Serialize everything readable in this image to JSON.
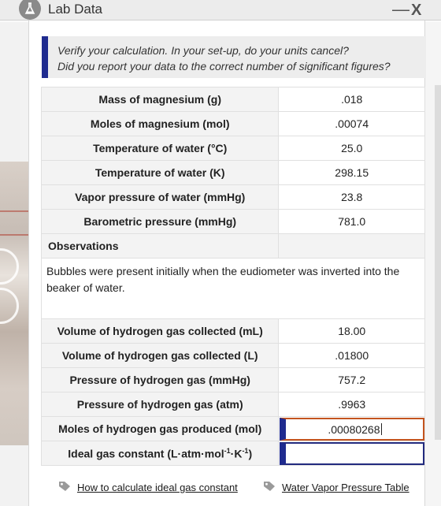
{
  "window": {
    "title": "Lab Data",
    "minimize_label": "—",
    "close_label": "X"
  },
  "notice": {
    "line1": "Verify your calculation. In your set-up, do your units cancel?",
    "line2": "Did you report your data to the correct number of significant figures?"
  },
  "rows_top": [
    {
      "label": "Mass of magnesium (g)",
      "value": ".018"
    },
    {
      "label": "Moles of magnesium (mol)",
      "value": ".00074"
    },
    {
      "label": "Temperature of water (°C)",
      "value": "25.0"
    },
    {
      "label": "Temperature of water (K)",
      "value": "298.15"
    },
    {
      "label": "Vapor pressure of water (mmHg)",
      "value": "23.8"
    },
    {
      "label": "Barometric pressure (mmHg)",
      "value": "781.0"
    }
  ],
  "observations": {
    "label": "Observations",
    "text": "Bubbles were present initially when the eudiometer was inverted into the beaker of water."
  },
  "rows_bottom": [
    {
      "label": "Volume of hydrogen gas collected (mL)",
      "value": "18.00"
    },
    {
      "label": "Volume of hydrogen gas collected (L)",
      "value": ".01800"
    },
    {
      "label": "Pressure of hydrogen gas (mmHg)",
      "value": "757.2"
    },
    {
      "label": "Pressure of hydrogen gas (atm)",
      "value": ".9963"
    }
  ],
  "inputs": {
    "moles_h2": {
      "label": "Moles of hydrogen gas produced (mol)",
      "value": ".00080268"
    },
    "gas_constant": {
      "label_main": "Ideal gas constant (L·atm·mol",
      "sup1": "-1",
      "label_mid": "·K",
      "sup2": "-1",
      "label_end": ")",
      "value": ""
    }
  },
  "links": {
    "ideal_gas": "How to calculate ideal gas constant",
    "vapor_table": "Water Vapor Pressure Table"
  },
  "colors": {
    "accent": "#1f2b8f",
    "active_border": "#c4541e"
  }
}
